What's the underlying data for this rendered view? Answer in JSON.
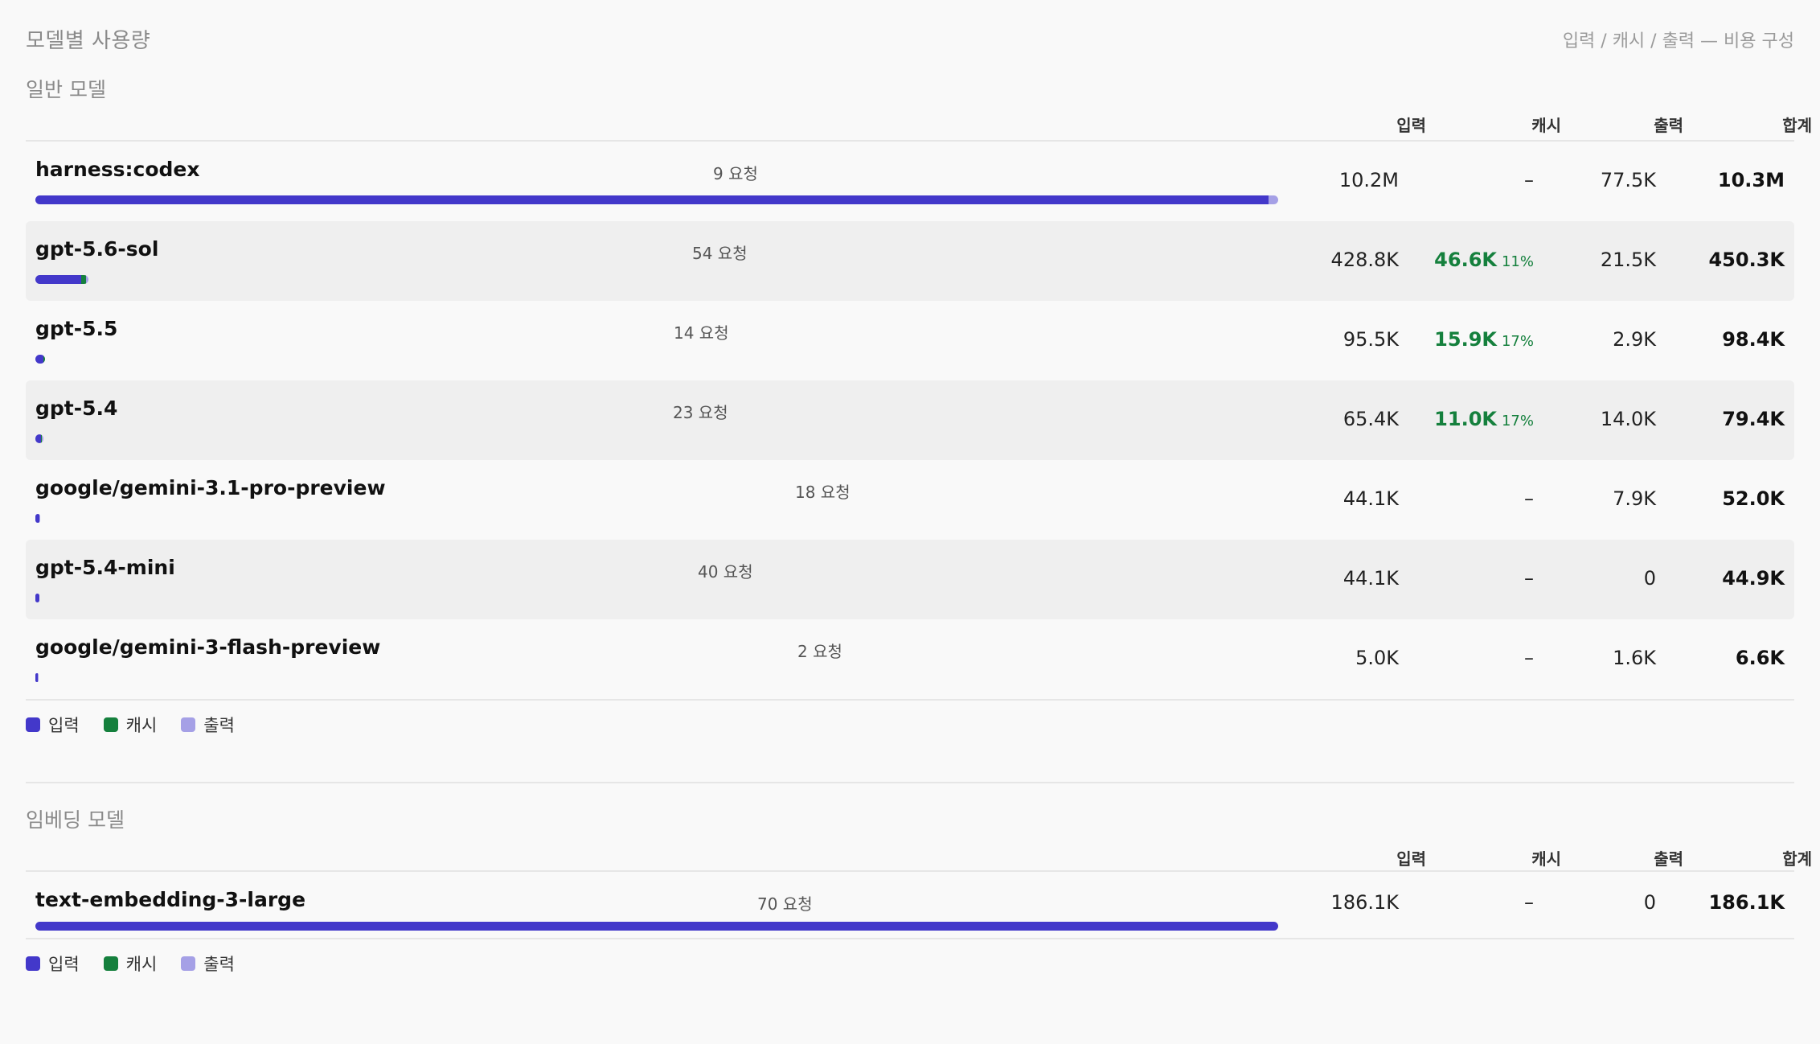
{
  "header": {
    "title": "모델별 사용량",
    "subtitle": "입력 / 캐시 / 출력 — 비용 구성"
  },
  "columns": {
    "input": "입력",
    "cache": "캐시",
    "output": "출력",
    "total": "합계"
  },
  "colors": {
    "input": "#4338ca",
    "cache": "#15803d",
    "output": "#a5a0e6"
  },
  "legend": [
    {
      "key": "input",
      "label": "입력"
    },
    {
      "key": "cache",
      "label": "캐시"
    },
    {
      "key": "output",
      "label": "출력"
    }
  ],
  "general": {
    "title": "일반 모델",
    "rows": [
      {
        "name": "harness:codex",
        "requests": "9 요청",
        "input": "10.2M",
        "cache": "–",
        "cache_pct": "",
        "output": "77.5K",
        "total": "10.3M"
      },
      {
        "name": "gpt-5.6-sol",
        "requests": "54 요청",
        "input": "428.8K",
        "cache": "46.6K",
        "cache_pct": "11%",
        "output": "21.5K",
        "total": "450.3K"
      },
      {
        "name": "gpt-5.5",
        "requests": "14 요청",
        "input": "95.5K",
        "cache": "15.9K",
        "cache_pct": "17%",
        "output": "2.9K",
        "total": "98.4K"
      },
      {
        "name": "gpt-5.4",
        "requests": "23 요청",
        "input": "65.4K",
        "cache": "11.0K",
        "cache_pct": "17%",
        "output": "14.0K",
        "total": "79.4K"
      },
      {
        "name": "google/gemini-3.1-pro-preview",
        "requests": "18 요청",
        "input": "44.1K",
        "cache": "–",
        "cache_pct": "",
        "output": "7.9K",
        "total": "52.0K"
      },
      {
        "name": "gpt-5.4-mini",
        "requests": "40 요청",
        "input": "44.1K",
        "cache": "–",
        "cache_pct": "",
        "output": "0",
        "total": "44.9K"
      },
      {
        "name": "google/gemini-3-flash-preview",
        "requests": "2 요청",
        "input": "5.0K",
        "cache": "–",
        "cache_pct": "",
        "output": "1.6K",
        "total": "6.6K"
      }
    ]
  },
  "embedding": {
    "title": "임베딩 모델",
    "rows": [
      {
        "name": "text-embedding-3-large",
        "requests": "70 요청",
        "input": "186.1K",
        "cache": "–",
        "cache_pct": "",
        "output": "0",
        "total": "186.1K"
      }
    ]
  }
}
